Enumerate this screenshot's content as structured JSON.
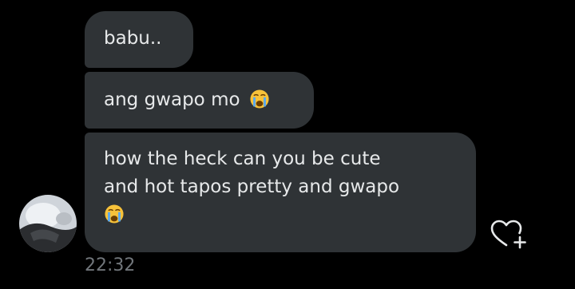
{
  "messages": [
    {
      "text": "babu.."
    },
    {
      "text": "ang gwapo mo",
      "emoji": "loudly-crying-face"
    },
    {
      "line1": "how the heck can you be cute",
      "line2": "and hot tapos pretty and gwapo",
      "emoji": "loudly-crying-face"
    }
  ],
  "timestamp": "22:32",
  "colors": {
    "background": "#000000",
    "bubble": "#2f3336",
    "text": "#e7e9ea",
    "muted": "#71767b"
  },
  "icons": {
    "react": "heart-plus-icon",
    "emoji": "loudly-crying-face-icon"
  }
}
